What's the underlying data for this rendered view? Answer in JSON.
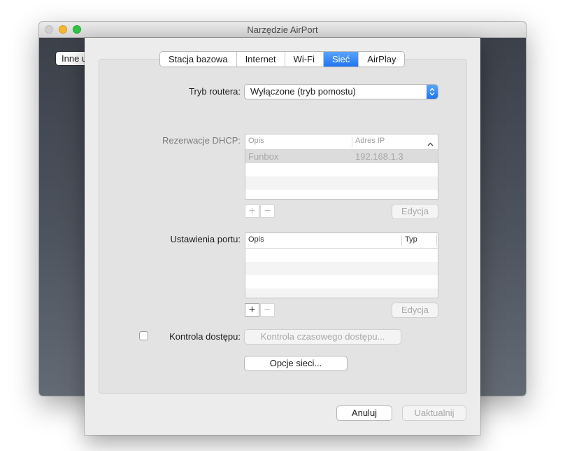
{
  "window": {
    "title": "Narzędzie AirPort",
    "background_button_label": "Inne u"
  },
  "tabs": [
    {
      "label": "Stacja bazowa"
    },
    {
      "label": "Internet"
    },
    {
      "label": "Wi-Fi"
    },
    {
      "label": "Sieć",
      "active": true
    },
    {
      "label": "AirPlay"
    }
  ],
  "router_mode": {
    "label": "Tryb routera:",
    "value": "Wyłączone (tryb pomostu)"
  },
  "dhcp": {
    "label": "Rezerwacje DHCP:",
    "columns": [
      "Opis",
      "Adres IP"
    ],
    "sort_indicator": "^",
    "rows": [
      {
        "desc": "Funbox",
        "ip": "192.168.1.3"
      }
    ],
    "add_label": "+",
    "remove_label": "−",
    "edit_label": "Edycja"
  },
  "ports": {
    "label": "Ustawienia portu:",
    "columns": [
      "Opis",
      "Typ"
    ],
    "add_label": "+",
    "remove_label": "−",
    "edit_label": "Edycja"
  },
  "access_control": {
    "checkbox_label": "Kontrola dostępu:",
    "checked": false,
    "timed_button": "Kontrola czasowego dostępu..."
  },
  "network_options_button": "Opcje sieci...",
  "footer": {
    "cancel": "Anuluj",
    "update": "Uaktualnij"
  },
  "colors": {
    "accent": "#1f75f2",
    "window_dark": "#3a3f48"
  }
}
